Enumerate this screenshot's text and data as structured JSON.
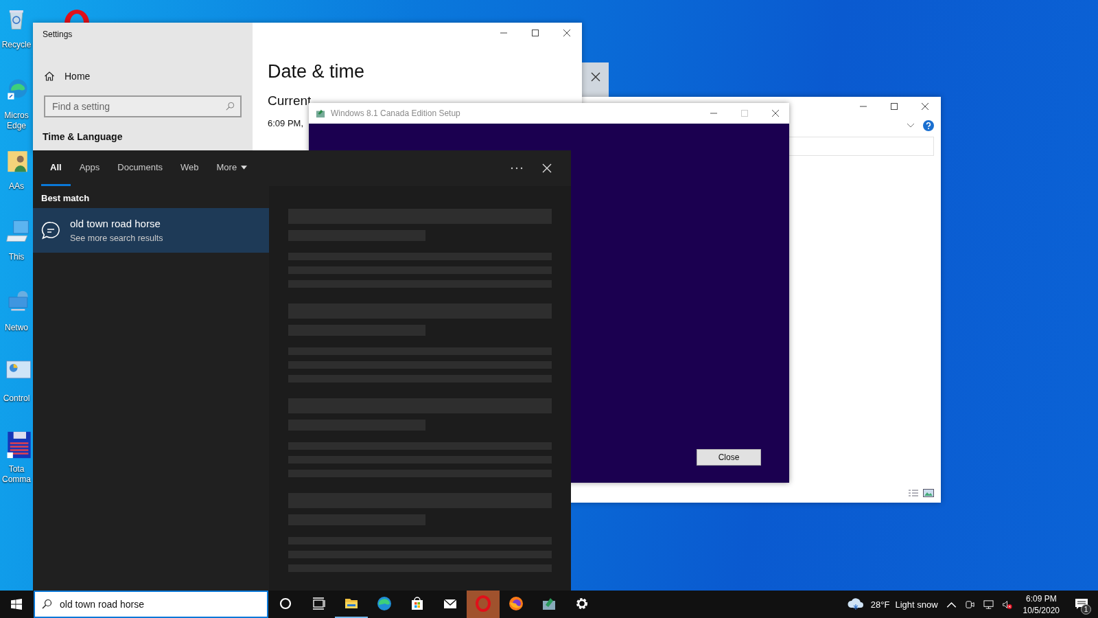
{
  "desktop_icons": [
    {
      "kind": "recycle",
      "lines": [
        "Recycle"
      ]
    },
    {
      "kind": "edge",
      "lines": [
        "Micros",
        "Edge"
      ]
    },
    {
      "kind": "user-folder",
      "lines": [
        "AAs"
      ]
    },
    {
      "kind": "computer",
      "lines": [
        "This"
      ]
    },
    {
      "kind": "network",
      "lines": [
        "Netwo"
      ]
    },
    {
      "kind": "control",
      "lines": [
        "Control"
      ]
    },
    {
      "kind": "commander",
      "lines": [
        "Tota",
        "Comma"
      ]
    }
  ],
  "settings_window": {
    "title": "Settings",
    "home": "Home",
    "search": {
      "placeholder": "Find a setting"
    },
    "section": "Time & Language",
    "heading": "Date & time",
    "subheading": "Current",
    "time": "6:09 PM,"
  },
  "setup_window": {
    "title": "Windows 8.1 Canada Edition Setup",
    "button": "Close"
  },
  "search_panel": {
    "tabs": [
      {
        "label": "All",
        "selected": true,
        "kind": "tab"
      },
      {
        "label": "Apps",
        "selected": false,
        "kind": "tab"
      },
      {
        "label": "Documents",
        "selected": false,
        "kind": "tab"
      },
      {
        "label": "Web",
        "selected": false,
        "kind": "tab"
      },
      {
        "label": "More",
        "selected": false,
        "kind": "menu"
      }
    ],
    "section": "Best match",
    "result": {
      "title": "old town road horse",
      "subtitle": "See more search results",
      "selected": true
    }
  },
  "taskbar": {
    "search": {
      "value": "old town road horse"
    },
    "apps": [
      {
        "kind": "cortana",
        "running": false,
        "active": false
      },
      {
        "kind": "taskview",
        "running": false,
        "active": false
      },
      {
        "kind": "explorer",
        "running": true,
        "active": false
      },
      {
        "kind": "edge",
        "running": false,
        "active": false
      },
      {
        "kind": "store",
        "running": false,
        "active": false
      },
      {
        "kind": "mail",
        "running": false,
        "active": false
      },
      {
        "kind": "opera",
        "running": false,
        "active": true
      },
      {
        "kind": "firefox",
        "running": false,
        "active": false
      },
      {
        "kind": "setup",
        "running": false,
        "active": false
      },
      {
        "kind": "settings",
        "running": false,
        "active": false
      }
    ],
    "weather": {
      "temperature": "28°F",
      "condition": "Light snow"
    },
    "volume": {
      "muted": true
    },
    "clock": {
      "time": "6:09 PM",
      "date": "10/5/2020"
    },
    "notifications": {
      "count": "1"
    }
  }
}
